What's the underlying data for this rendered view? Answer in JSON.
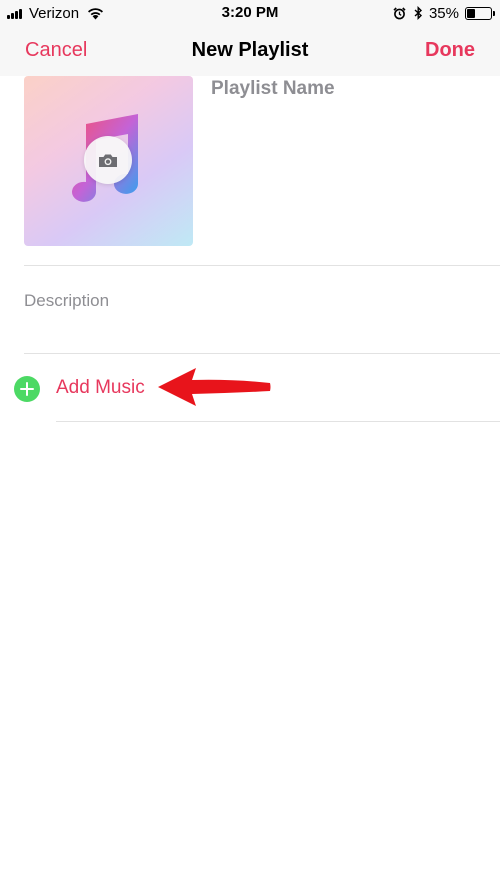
{
  "status_bar": {
    "carrier": "Verizon",
    "time": "3:20 PM",
    "battery_percent": "35%",
    "battery_level": 0.35,
    "icons": [
      "signal-icon",
      "wifi-icon",
      "alarm-icon",
      "bluetooth-icon",
      "battery-icon"
    ]
  },
  "nav": {
    "cancel_label": "Cancel",
    "title": "New Playlist",
    "done_label": "Done"
  },
  "form": {
    "artwork_icon": "music-note-icon",
    "camera_icon": "camera-icon",
    "name_placeholder": "Playlist Name",
    "description_placeholder": "Description",
    "add_music_label": "Add Music",
    "add_icon": "plus-circle-icon"
  },
  "annotation": {
    "icon": "red-arrow-icon"
  },
  "colors": {
    "accent": "#e7385d",
    "add_green": "#4cd964",
    "placeholder": "#8e8e93",
    "bar_background": "#f7f7f7",
    "annotation_red": "#e8141b"
  }
}
